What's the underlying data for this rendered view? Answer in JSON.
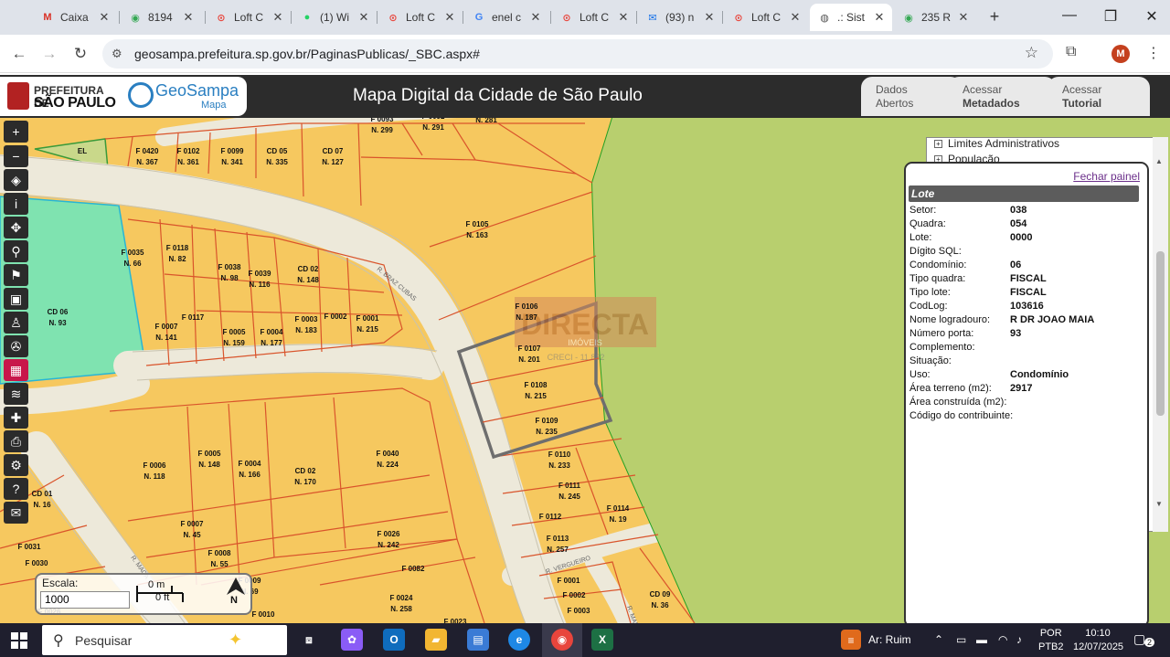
{
  "browser": {
    "tabs": [
      {
        "icon": "gmail-icon",
        "label": "Caixa"
      },
      {
        "icon": "maps-pin-icon",
        "label": "8194"
      },
      {
        "icon": "loft-icon",
        "label": "Loft C"
      },
      {
        "icon": "whatsapp-icon",
        "label": "(1) Wi"
      },
      {
        "icon": "loft-icon",
        "label": "Loft C"
      },
      {
        "icon": "google-icon",
        "label": "enel c"
      },
      {
        "icon": "loft-icon",
        "label": "Loft C"
      },
      {
        "icon": "mail-icon",
        "label": "(93) n"
      },
      {
        "icon": "loft-icon",
        "label": "Loft C"
      },
      {
        "icon": "globe-icon",
        "label": ".: Sist"
      },
      {
        "icon": "maps-pin-icon",
        "label": "235 R"
      }
    ],
    "url": "geosampa.prefeitura.sp.gov.br/PaginasPublicas/_SBC.aspx#",
    "profile_initial": "M"
  },
  "header": {
    "pref_line1": "PREFEITURA DE",
    "pref_line2": "SÃO PAULO",
    "geosampa": "GeoSampa",
    "geosampa_sub": "Mapa",
    "title": "Mapa Digital da Cidade de São Paulo",
    "tabs": [
      {
        "line1": "Dados",
        "line2": "Abertos"
      },
      {
        "line1": "Acessar",
        "line2": "Metadados"
      },
      {
        "line1": "Acessar",
        "line2": "Tutorial"
      }
    ]
  },
  "map": {
    "watermark": "DIRECTA",
    "watermark_sub": "IMÓVEIS",
    "watermark_creci": "CRECI - 11.882",
    "street_labels": [
      "R. BRAZ CUBAS",
      "R. VERGUEIRO",
      "R. MACA",
      "R. MARAJO"
    ],
    "lots": [
      {
        "id": "EL",
        "num": ""
      },
      {
        "id": "F 0420",
        "num": "N. 367"
      },
      {
        "id": "F 0102",
        "num": "N. 361"
      },
      {
        "id": "F 0099",
        "num": "N. 341"
      },
      {
        "id": "CD 05",
        "num": "N. 335"
      },
      {
        "id": "CD 07",
        "num": "N. 127"
      },
      {
        "id": "F 0093",
        "num": "N. 299"
      },
      {
        "id": "F 0092",
        "num": "N. 291"
      },
      {
        "id": "F 0091",
        "num": "N. 281"
      },
      {
        "id": "CD 02",
        "num": ""
      },
      {
        "id": "F 0105",
        "num": "N. 163"
      },
      {
        "id": "F 0035",
        "num": "N. 66"
      },
      {
        "id": "F 0118",
        "num": "N. 82"
      },
      {
        "id": "F 0038",
        "num": "N. 98"
      },
      {
        "id": "F 0039",
        "num": "N. 116"
      },
      {
        "id": "CD 02",
        "num": "N. 148"
      },
      {
        "id": "CD 06",
        "num": "N. 93"
      },
      {
        "id": "F 0007",
        "num": "N. 141"
      },
      {
        "id": "F 0117",
        "num": ""
      },
      {
        "id": "F 0005",
        "num": "N. 159"
      },
      {
        "id": "F 0004",
        "num": "N. 177"
      },
      {
        "id": "F 0003",
        "num": "N. 183"
      },
      {
        "id": "F 0002",
        "num": ""
      },
      {
        "id": "F 0001",
        "num": "N. 215"
      },
      {
        "id": "F 0106",
        "num": "N. 187"
      },
      {
        "id": "F 0107",
        "num": "N. 201"
      },
      {
        "id": "F 0108",
        "num": "N. 215"
      },
      {
        "id": "F 0109",
        "num": "N. 235"
      },
      {
        "id": "F 0110",
        "num": "N. 233"
      },
      {
        "id": "F 0111",
        "num": "N. 245"
      },
      {
        "id": "F 0112",
        "num": ""
      },
      {
        "id": "F 0114",
        "num": "N. 19"
      },
      {
        "id": "F 0113",
        "num": "N. 257"
      },
      {
        "id": "F 0006",
        "num": "N. 118"
      },
      {
        "id": "F 0005",
        "num": "N. 148"
      },
      {
        "id": "F 0004",
        "num": "N. 166"
      },
      {
        "id": "CD 02",
        "num": "N. 170"
      },
      {
        "id": "F 0040",
        "num": "N. 224"
      },
      {
        "id": "CD 01",
        "num": "N. 16"
      },
      {
        "id": "F 0007",
        "num": "N. 45"
      },
      {
        "id": "F 0026",
        "num": "N. 242"
      },
      {
        "id": "F 0031",
        "num": ""
      },
      {
        "id": "F 0030",
        "num": ""
      },
      {
        "id": "F 0008",
        "num": "N. 55"
      },
      {
        "id": "F 0082",
        "num": ""
      },
      {
        "id": "F 0009",
        "num": "N. 69"
      },
      {
        "id": "F 0024",
        "num": "N. 258"
      },
      {
        "id": "F 0026",
        "num": ""
      },
      {
        "id": "F 0010",
        "num": ""
      },
      {
        "id": "F 0023",
        "num": ""
      },
      {
        "id": "F 0001",
        "num": ""
      },
      {
        "id": "F 0002",
        "num": ""
      },
      {
        "id": "F 0003",
        "num": ""
      },
      {
        "id": "CD 09",
        "num": "N. 36"
      }
    ]
  },
  "scale": {
    "label": "Escala:",
    "value": "1000",
    "meters": "0 m",
    "feet": "0 ft",
    "north": "N"
  },
  "layers": {
    "items": [
      "Limites Administrativos",
      "População"
    ]
  },
  "panel": {
    "close_label": "Fechar painel",
    "title": "Lote",
    "fields": [
      {
        "label": "Setor:",
        "value": "038"
      },
      {
        "label": "Quadra:",
        "value": "054"
      },
      {
        "label": "Lote:",
        "value": "0000"
      },
      {
        "label": "Dígito SQL:",
        "value": ""
      },
      {
        "label": "Condomínio:",
        "value": "06"
      },
      {
        "label": "Tipo quadra:",
        "value": "FISCAL"
      },
      {
        "label": "Tipo lote:",
        "value": "FISCAL"
      },
      {
        "label": "CodLog:",
        "value": "103616"
      },
      {
        "label": "Nome logradouro:",
        "value": "R DR JOAO MAIA"
      },
      {
        "label": "Número porta:",
        "value": "93"
      },
      {
        "label": "Complemento:",
        "value": ""
      },
      {
        "label": "Situação:",
        "value": ""
      },
      {
        "label": "Uso:",
        "value": "Condomínio"
      },
      {
        "label": "Área terreno (m2):",
        "value": "2917"
      },
      {
        "label": "Área construída (m2):",
        "value": ""
      },
      {
        "label": "Código do contribuinte:",
        "value": ""
      }
    ]
  },
  "taskbar": {
    "search_placeholder": "Pesquisar",
    "weather": "Ar: Ruim",
    "lang1": "POR",
    "lang2": "PTB2",
    "time": "10:10",
    "date": "12/07/2025",
    "notifications": "2"
  },
  "colors": {
    "lot_fill": "#f6c85f",
    "lot_border": "#d9542b",
    "street": "#f2efe4",
    "green_area": "#7fe3b0",
    "park": "#b8cf6e",
    "selected": "#6e6e6e"
  }
}
